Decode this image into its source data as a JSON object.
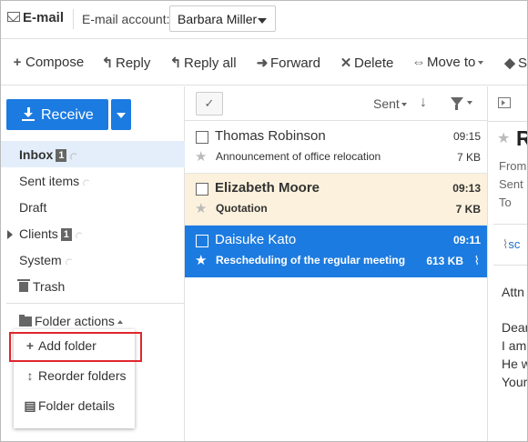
{
  "header": {
    "app_title": "E-mail",
    "account_label": "E-mail account:",
    "account_selected": "Barbara Miller"
  },
  "toolbar": {
    "compose": "Compose",
    "reply": "Reply",
    "reply_all": "Reply all",
    "forward": "Forward",
    "delete": "Delete",
    "move_to": "Move to",
    "more_partial": "S"
  },
  "sidebar": {
    "receive_label": "Receive",
    "folders": [
      {
        "name": "Inbox",
        "badge": "1"
      },
      {
        "name": "Sent items"
      },
      {
        "name": "Draft"
      },
      {
        "name": "Clients",
        "badge": "1"
      },
      {
        "name": "System"
      },
      {
        "name": "Trash"
      }
    ],
    "folder_actions_label": "Folder actions",
    "menu": {
      "add_folder": "Add folder",
      "reorder_folders": "Reorder folders",
      "folder_details": "Folder details"
    }
  },
  "list": {
    "sort_label": "Sent",
    "messages": [
      {
        "sender": "Thomas Robinson",
        "time": "09:15",
        "subject": "Announcement of office relocation",
        "size": "7 KB",
        "state": "read"
      },
      {
        "sender": "Elizabeth Moore",
        "time": "09:13",
        "subject": "Quotation",
        "size": "7 KB",
        "state": "unread"
      },
      {
        "sender": "Daisuke Kato",
        "time": "09:11",
        "subject": "Rescheduling of the regular meeting",
        "size": "613 KB",
        "state": "selected",
        "has_attachment": true
      }
    ]
  },
  "preview": {
    "subject_partial": "R",
    "field_from": "From",
    "field_sent": "Sent",
    "field_to": "To",
    "attachment_partial": "sc",
    "body_lines": [
      "Attn",
      "Dear",
      "I am",
      "He w",
      "Your"
    ]
  },
  "colors": {
    "accent": "#1c7be0",
    "unread_row": "#fbf1dc",
    "selected_folder": "#e3eefa",
    "highlight": "#e0262b"
  }
}
